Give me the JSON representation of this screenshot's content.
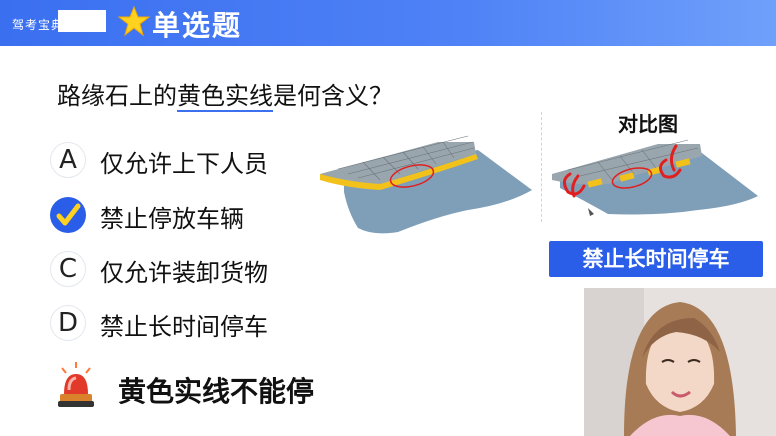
{
  "header": {
    "brand": "驾考宝典",
    "title": "单选题",
    "bg_color": "#3d72f0"
  },
  "question": {
    "pre": "路缘石上的",
    "highlight": "黄色实线",
    "post": "是何含义？"
  },
  "options": [
    {
      "letter": "A",
      "text": "仅允许上下人员",
      "selected": false
    },
    {
      "letter": "",
      "text": "禁止停放车辆",
      "selected": true,
      "icon": "check-icon"
    },
    {
      "letter": "C",
      "text": "仅允许装卸货物",
      "selected": false
    },
    {
      "letter": "D",
      "text": "禁止长时间停车",
      "selected": false
    }
  ],
  "summary": {
    "icon": "siren-icon",
    "text": "黄色实线不能停"
  },
  "compare": {
    "title": "对比图",
    "badge": "禁止长时间停车"
  },
  "colors": {
    "accent": "#2a5ee8",
    "curb_yellow": "#f3c21a",
    "water": "#7f9fb8",
    "mark_red": "#e02020"
  }
}
